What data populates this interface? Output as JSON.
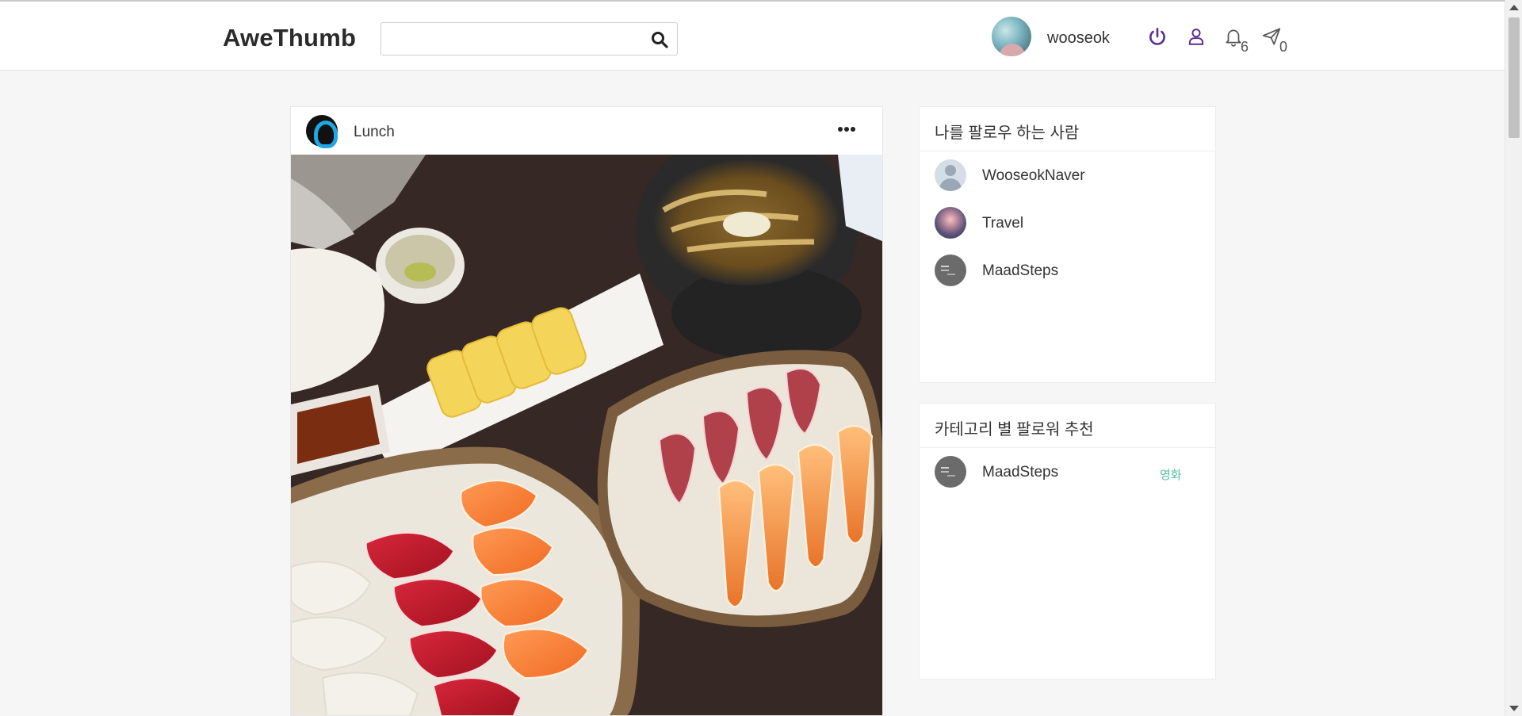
{
  "app": {
    "logo": "AweThumb"
  },
  "search": {
    "placeholder": "",
    "value": ""
  },
  "nav": {
    "username": "wooseok",
    "notifications_count": "6",
    "messages_count": "0",
    "accent_color": "#5b2d8e"
  },
  "post": {
    "title": "Lunch",
    "image_description": "sushi lunch photo"
  },
  "followers_card": {
    "title": "나를 팔로우 하는 사람",
    "users": [
      {
        "name": "WooseokNaver"
      },
      {
        "name": "Travel"
      },
      {
        "name": "MaadSteps"
      }
    ]
  },
  "recommend_card": {
    "title": "카테고리 별 팔로워 추천",
    "users": [
      {
        "name": "MaadSteps",
        "category": "영화"
      }
    ]
  }
}
